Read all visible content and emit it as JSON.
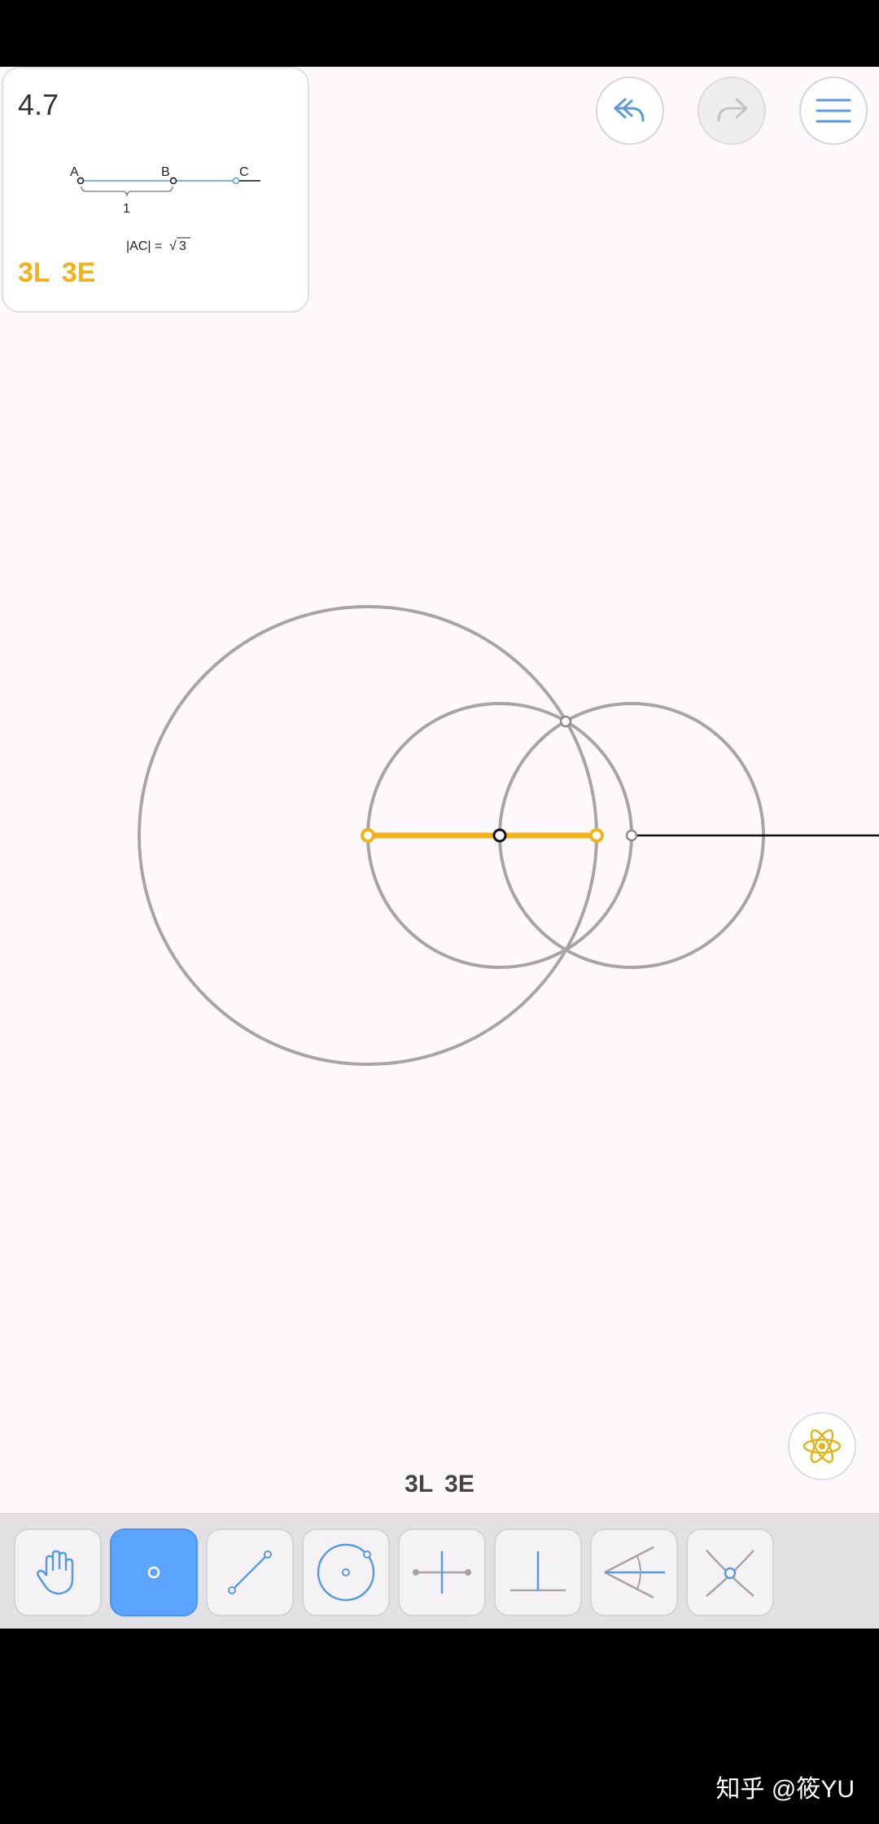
{
  "level": {
    "number": "4.7",
    "goal_l": "3L",
    "goal_e": "3E",
    "diagram": {
      "label_a": "A",
      "label_b": "B",
      "label_c": "C",
      "unit_label": "1",
      "formula_left": "|AC| =",
      "formula_radical": "√",
      "formula_value": "3"
    }
  },
  "moves": {
    "l": "3L",
    "e": "3E"
  },
  "icons": {
    "undo": "undo-icon",
    "redo": "redo-icon",
    "menu": "menu-icon",
    "hint": "atom-icon"
  },
  "toolbar": {
    "active_tool": "point",
    "tools": [
      "move",
      "point",
      "line",
      "circle",
      "perpendicular-bisector",
      "perpendicular",
      "angle-bisector",
      "intersect"
    ]
  },
  "colors": {
    "accent": "#f2b21b",
    "tool_blue": "#5ba4ff",
    "icon_blue": "#5b9bdc",
    "circle_gray": "#a8a3a7"
  },
  "watermark": "知乎 @筱YU"
}
